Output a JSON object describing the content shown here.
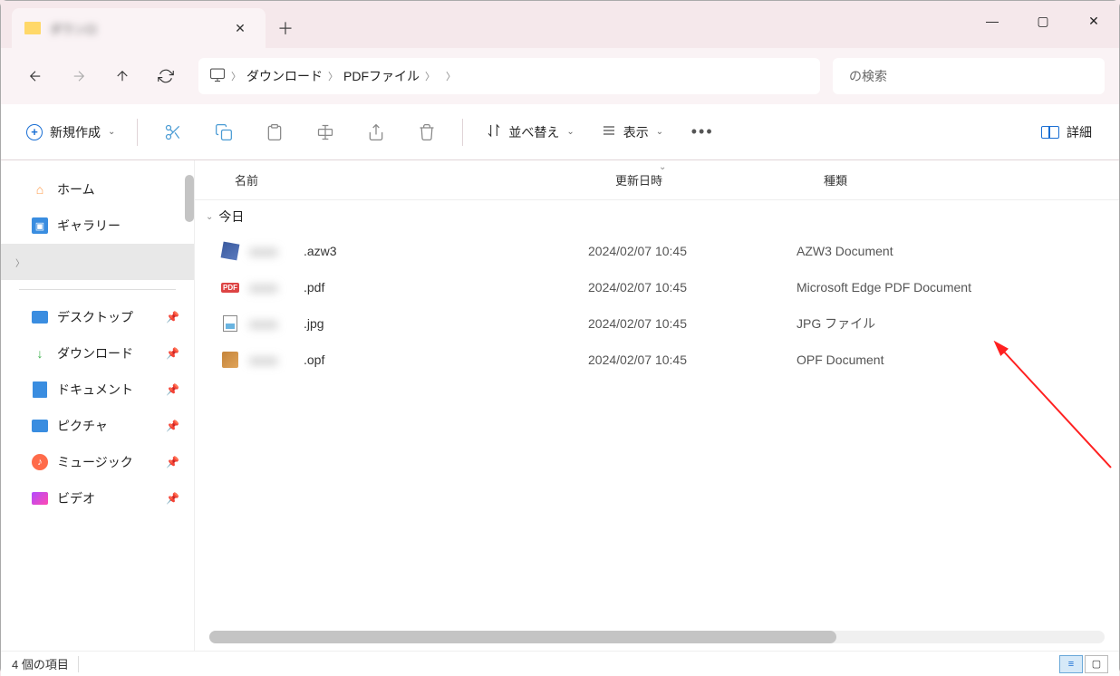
{
  "tab": {
    "title": "ダウンロ"
  },
  "breadcrumbs": {
    "seg1": "ダウンロード",
    "seg2": "PDFファイル",
    "seg3": "  ",
    "seg4": "  "
  },
  "search": {
    "prefix": "  ",
    "label": "の検索"
  },
  "toolbar": {
    "new_label": "新規作成",
    "sort_label": "並べ替え",
    "view_label": "表示",
    "details_label": "詳細"
  },
  "sidebar": {
    "home": "ホーム",
    "gallery": "ギャラリー",
    "cloud": "              ",
    "desktop": "デスクトップ",
    "downloads": "ダウンロード",
    "documents": "ドキュメント",
    "pictures": "ピクチャ",
    "music": "ミュージック",
    "videos": "ビデオ"
  },
  "columns": {
    "name": "名前",
    "date": "更新日時",
    "type": "種類"
  },
  "group": {
    "today": "今日"
  },
  "files": [
    {
      "ext": ".azw3",
      "date": "2024/02/07 10:45",
      "type": "AZW3 Document",
      "icon": "azw3"
    },
    {
      "ext": ".pdf",
      "date": "2024/02/07 10:45",
      "type": "Microsoft Edge PDF Document",
      "icon": "pdf"
    },
    {
      "ext": ".jpg",
      "date": "2024/02/07 10:45",
      "type": "JPG ファイル",
      "icon": "jpg"
    },
    {
      "ext": ".opf",
      "date": "2024/02/07 10:45",
      "type": "OPF Document",
      "icon": "opf"
    }
  ],
  "status": {
    "count": "4 個の項目"
  }
}
